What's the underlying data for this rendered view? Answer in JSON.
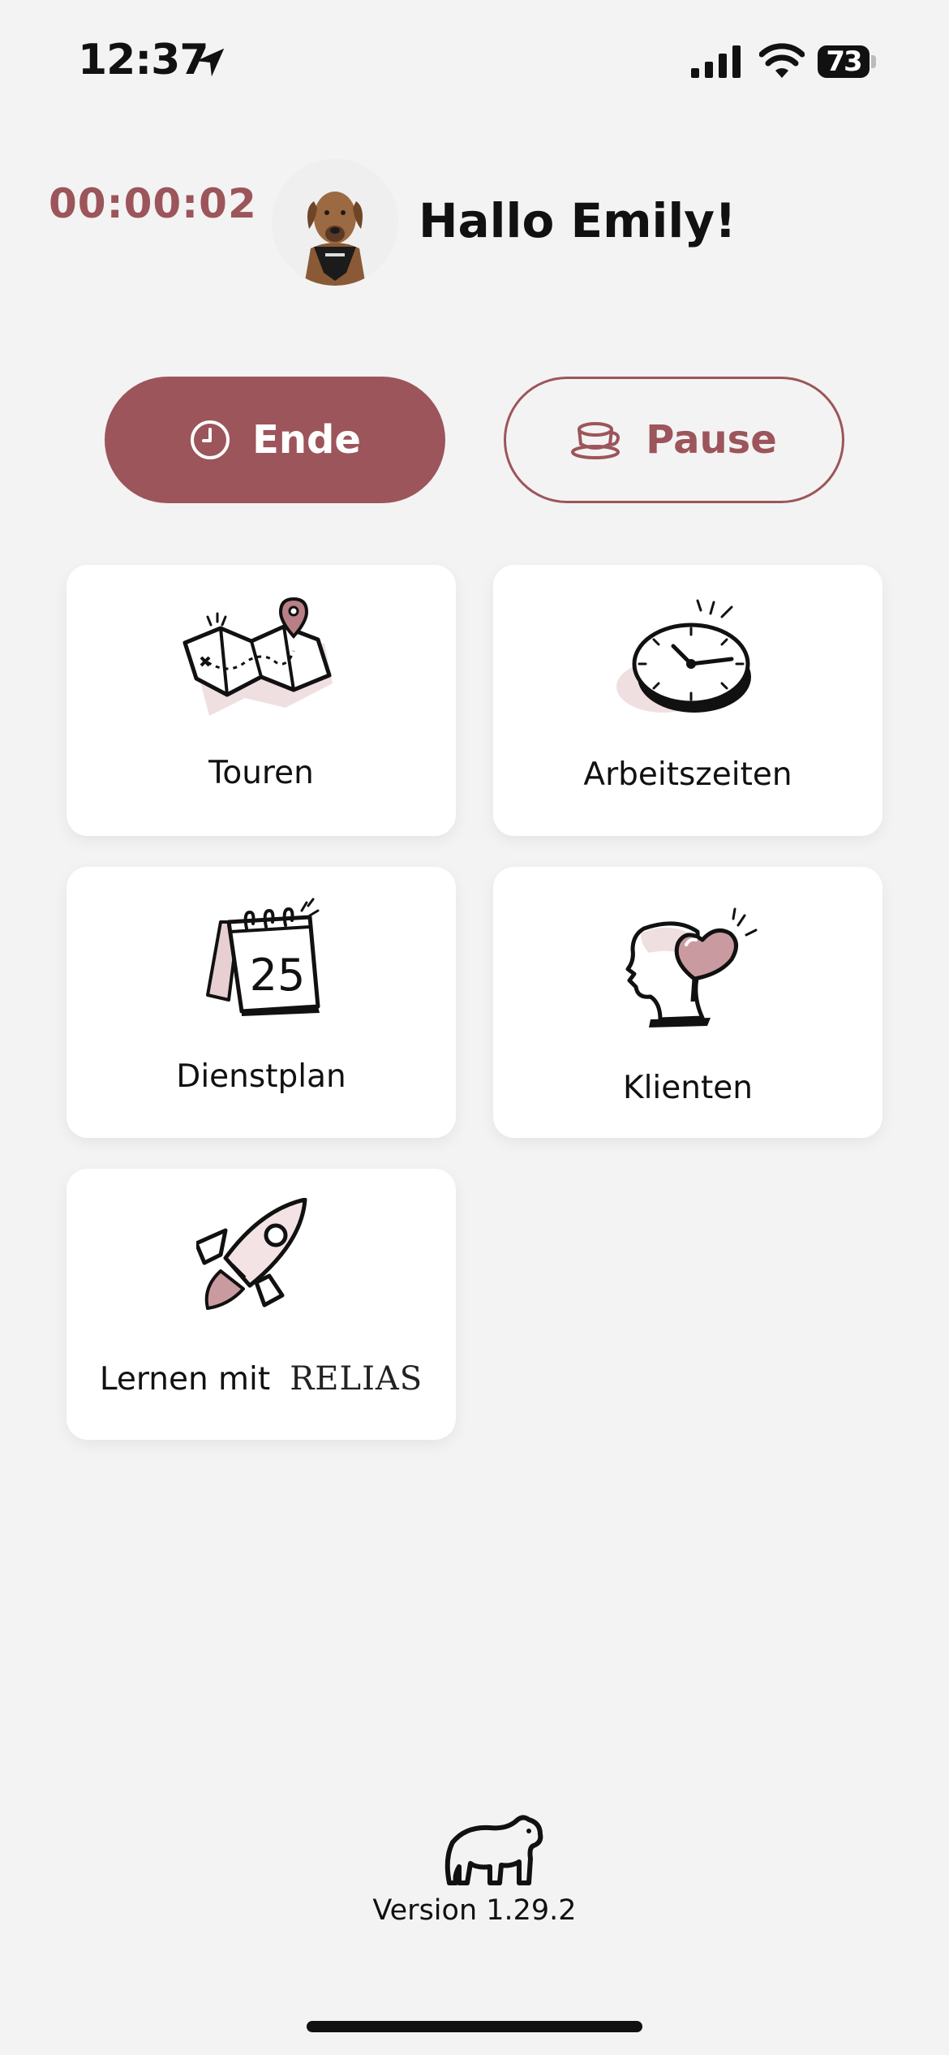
{
  "status_bar": {
    "time": "12:37",
    "battery": "73"
  },
  "header": {
    "timer": "00:00:02",
    "greeting": "Hallo Emily!"
  },
  "actions": {
    "end_label": "Ende",
    "pause_label": "Pause"
  },
  "tiles": [
    {
      "label": "Touren",
      "icon": "map-icon"
    },
    {
      "label": "Arbeitszeiten",
      "icon": "stopwatch-icon"
    },
    {
      "label": "Dienstplan",
      "icon": "calendar-icon",
      "calendar_day": "25"
    },
    {
      "label": "Klienten",
      "icon": "head-heart-icon"
    },
    {
      "label": "Lernen mit",
      "icon": "rocket-icon",
      "brand": "RELIAS"
    }
  ],
  "footer": {
    "version": "Version 1.29.2"
  },
  "colors": {
    "accent": "#9c555a",
    "background": "#f3f3f3",
    "tile": "#ffffff",
    "pink": "#e7cfd2"
  }
}
